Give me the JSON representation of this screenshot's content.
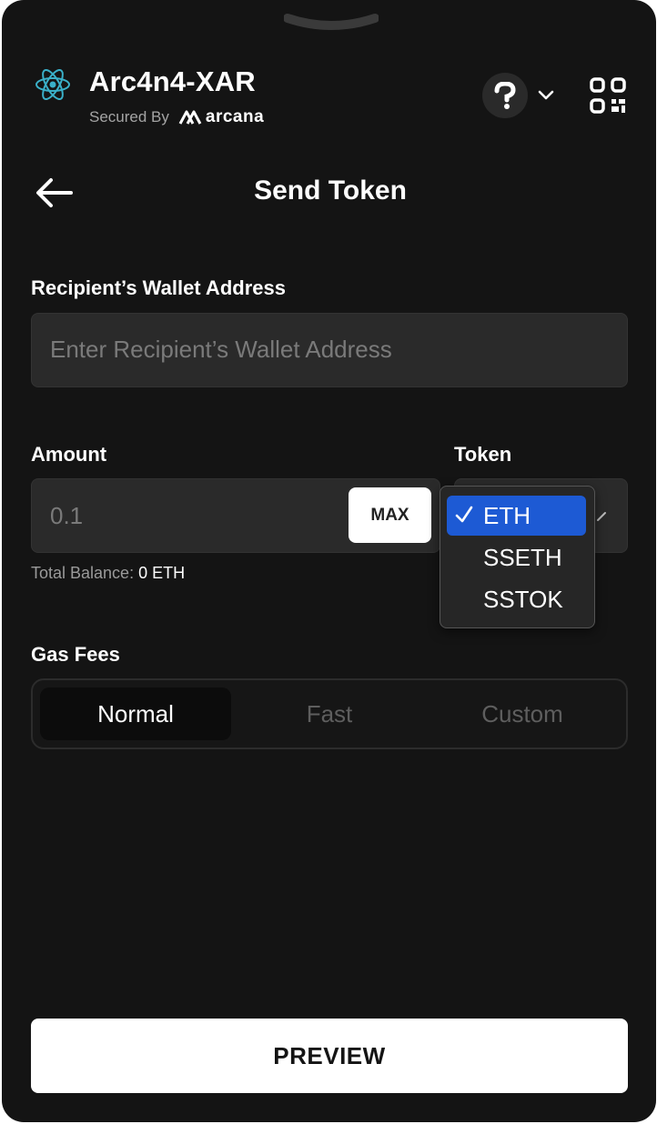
{
  "header": {
    "app_name": "Arc4n4-XAR",
    "secured_by": "Secured By",
    "brand": "arcana"
  },
  "nav": {
    "title": "Send Token"
  },
  "recipient": {
    "label": "Recipient’s Wallet Address",
    "placeholder": "Enter Recipient’s Wallet Address"
  },
  "amount": {
    "label": "Amount",
    "value": "0.1",
    "max_label": "MAX",
    "balance_label": "Total Balance:",
    "balance_value": "0 ETH"
  },
  "token": {
    "label": "Token",
    "options": [
      "ETH",
      "SSETH",
      "SSTOK"
    ],
    "selected": "ETH"
  },
  "gas": {
    "label": "Gas Fees",
    "options": [
      "Normal",
      "Fast",
      "Custom"
    ],
    "selected": "Normal"
  },
  "footer": {
    "preview_label": "PREVIEW"
  },
  "colors": {
    "background": "#141414",
    "field": "#2a2a2a",
    "dropdown_highlight": "#1d5ad4",
    "logo_accent": "#3ab0c9"
  }
}
